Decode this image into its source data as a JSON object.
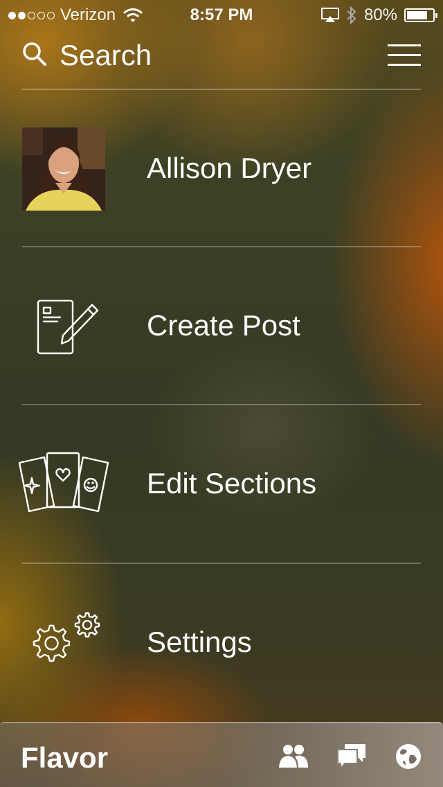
{
  "status_bar": {
    "carrier": "Verizon",
    "time": "8:57 PM",
    "battery_percent": "80%",
    "battery_level": 0.8,
    "signal_bars_filled": 2,
    "signal_bars_total": 5,
    "icons": [
      "wifi-icon",
      "airplay-icon",
      "bluetooth-icon",
      "battery-icon"
    ]
  },
  "header": {
    "search_label": "Search",
    "icons": [
      "search-icon",
      "hamburger-menu-icon"
    ]
  },
  "menu": {
    "items": [
      {
        "label": "Allison Dryer",
        "icon": "profile-avatar"
      },
      {
        "label": "Create Post",
        "icon": "compose-post-icon"
      },
      {
        "label": "Edit Sections",
        "icon": "sections-cards-icon"
      },
      {
        "label": "Settings",
        "icon": "gears-icon"
      }
    ]
  },
  "tab_bar": {
    "app_name": "Flavor",
    "icons": [
      "people-icon",
      "chat-bubbles-icon",
      "globe-icon"
    ]
  },
  "colors": {
    "text": "#ffffff",
    "accent_orange": "#b9550a",
    "background_olive": "#3b3e25"
  }
}
